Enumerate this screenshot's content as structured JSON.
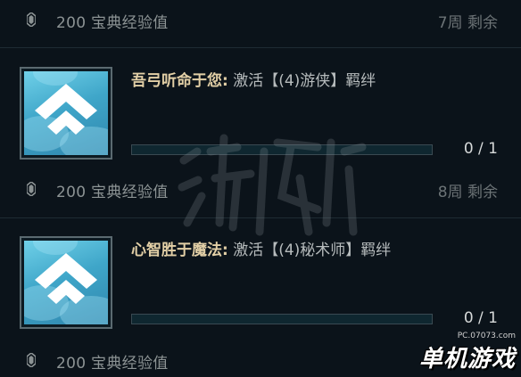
{
  "rewards": [
    {
      "text": "200 宝典经验值",
      "time": "7周 剩余"
    },
    {
      "text": "200 宝典经验值",
      "time": "8周 剩余"
    },
    {
      "text": "200 宝典经验值",
      "time": ""
    }
  ],
  "missions": [
    {
      "name": "吾弓听命于您:",
      "desc": "激活【(4)游侠】羁绊",
      "progress_text": "0 / 1",
      "progress": 0
    },
    {
      "name": "心智胜于魔法:",
      "desc": "激活【(4)秘术师】羁绊",
      "progress_text": "0 / 1",
      "progress": 0
    }
  ],
  "watermark": {
    "text": "游侠网"
  },
  "brand": {
    "url": "PC.07073.com",
    "name": "单机游戏"
  },
  "colors": {
    "background": "#0b131a",
    "title": "#e2cfa6",
    "icon": "#3fa6c9",
    "progress_track": "#0f2730"
  },
  "icons": {
    "reward": "gem-icon",
    "mission": "chevron-up-emblem-icon"
  }
}
